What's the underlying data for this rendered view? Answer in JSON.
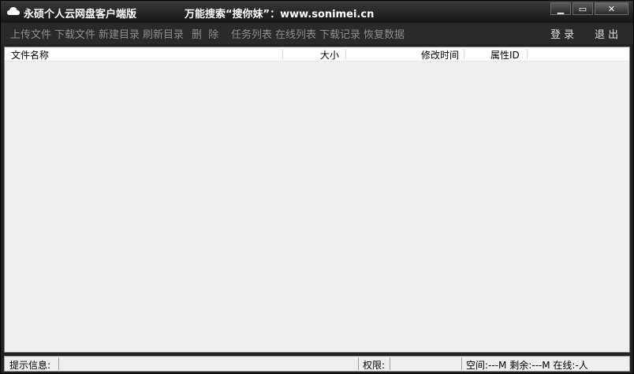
{
  "window": {
    "title": "永硕个人云网盘客户端版",
    "slogan": "万能搜索“搜你妹”：www.sonimei.cn",
    "controls": {
      "minimize": "▁",
      "maximize": "▭",
      "close": "✕"
    }
  },
  "toolbar": {
    "upload": "上传文件",
    "download": "下载文件",
    "new_dir": "新建目录",
    "refresh_dir": "刷新目录",
    "delete": "删  除",
    "task_list": "任务列表",
    "online_list": "在线列表",
    "download_log": "下载记录",
    "restore_data": "恢复数据",
    "login": "登 录",
    "logout": "退 出"
  },
  "list": {
    "columns": [
      "文件名称",
      "大小",
      "修改时间",
      "属性ID"
    ],
    "rows": []
  },
  "status": {
    "hint_label": "提示信息:",
    "hint_value": "",
    "perm_label": "权限:",
    "perm_value": "",
    "space_info": "空间:---M 剩余:---M 在线:-人"
  },
  "colors": {
    "titlebar": "#1a1a1a",
    "toolbar": "#2a2a2a",
    "toolbar_text": "#8d8d8d",
    "list_bg": "#f0f0f0"
  }
}
